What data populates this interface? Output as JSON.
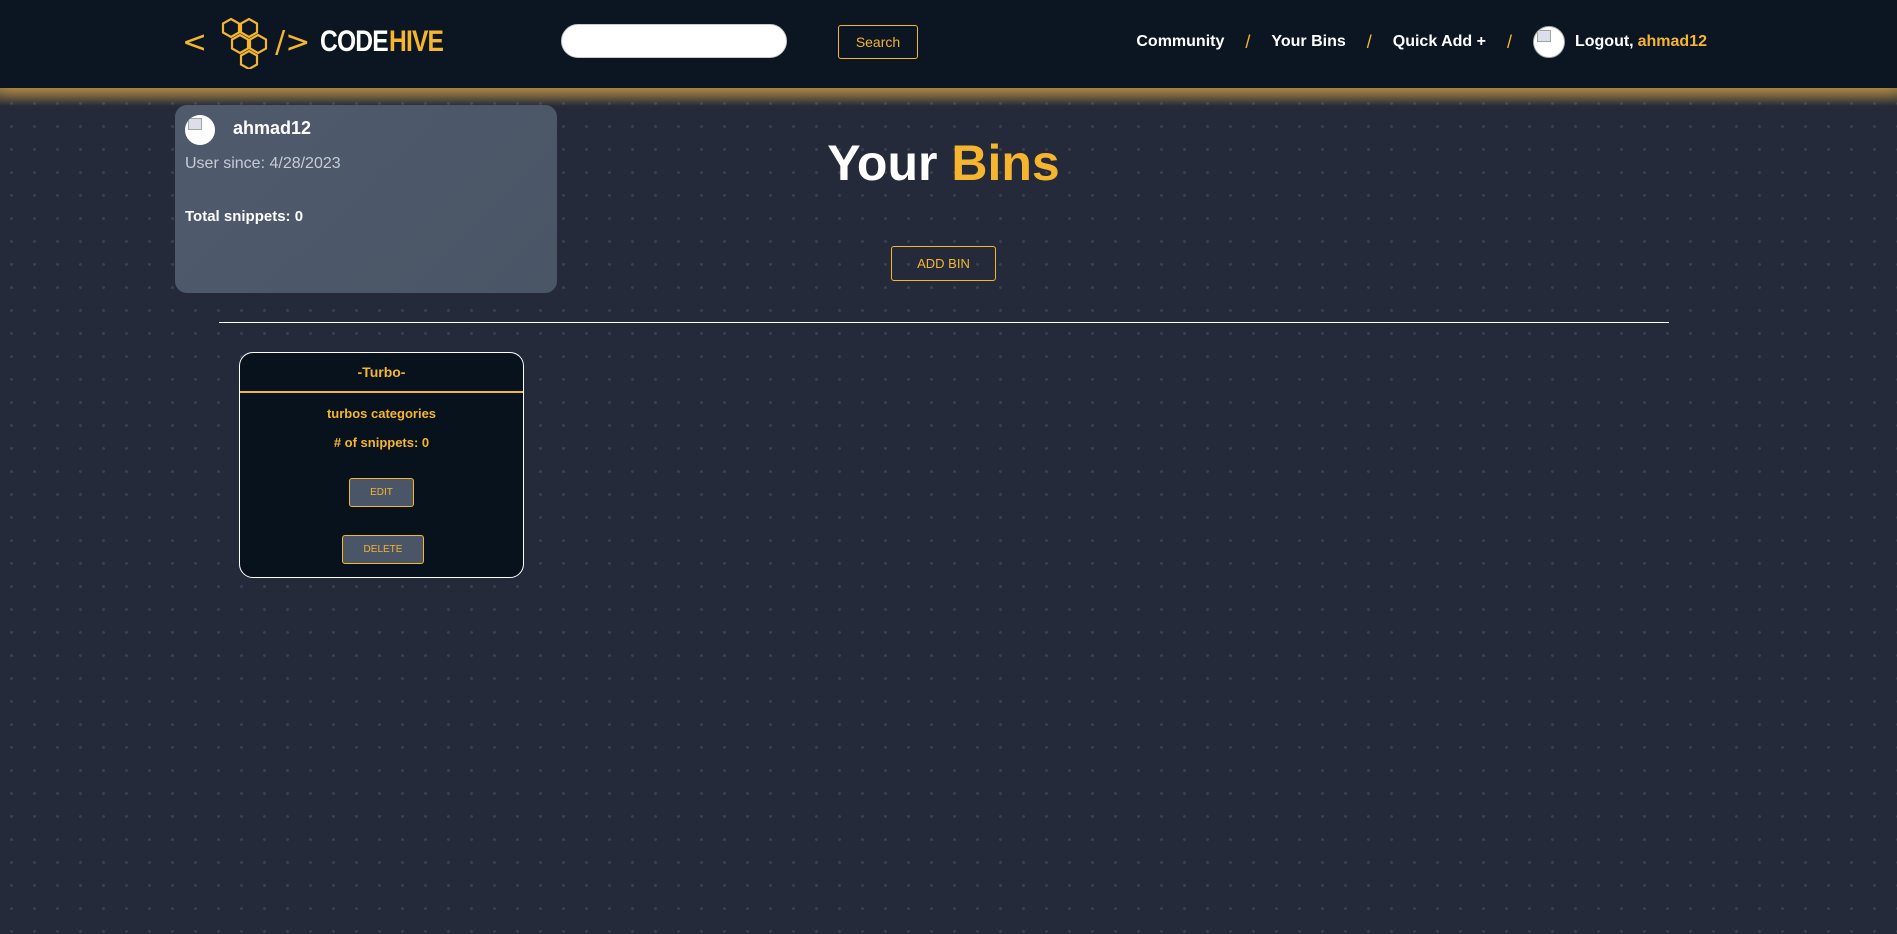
{
  "header": {
    "logo": {
      "bracket_open": "<",
      "bracket_close": "/>",
      "word1": "CODE",
      "word2": "HIVE",
      "icon": "honeycomb-icon"
    },
    "search": {
      "placeholder": "",
      "value": "",
      "button_label": "Search"
    },
    "nav": {
      "community": "Community",
      "your_bins": "Your Bins",
      "quick_add": "Quick Add +",
      "separator": "/",
      "logout_label": "Logout,",
      "username": "ahmad12",
      "avatar_icon": "user-avatar-icon"
    }
  },
  "profile": {
    "username": "ahmad12",
    "user_since": "User since: 4/28/2023",
    "total_snippets": "Total snippets: 0",
    "avatar_icon": "user-avatar-icon"
  },
  "main": {
    "title_word1": "Your",
    "title_word2": "Bins",
    "add_bin_label": "ADD BIN"
  },
  "bins": [
    {
      "title": "-Turbo-",
      "description": "turbos categories",
      "snippet_count": "# of snippets: 0",
      "edit_label": "EDIT",
      "delete_label": "DELETE"
    }
  ],
  "colors": {
    "accent": "#f5b52e",
    "navbar_bg": "#0b1622",
    "page_bg": "#252a3a",
    "card_bg": "#08121d",
    "profile_card_bg": "#4f5b6d"
  }
}
